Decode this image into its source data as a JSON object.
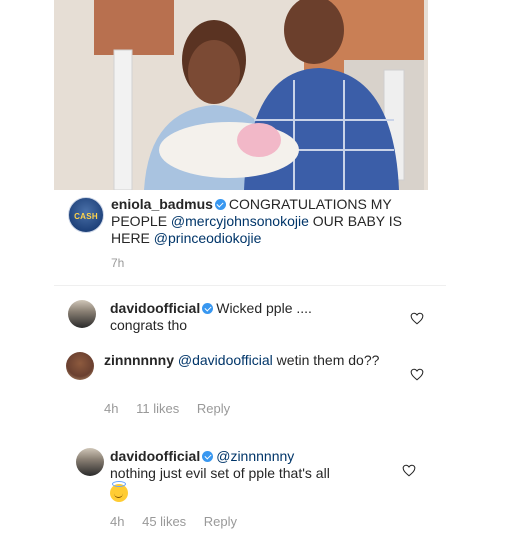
{
  "post": {
    "caption": {
      "username": "eniola_badmus",
      "avatar_text": "CASH",
      "segments": [
        {
          "t": "CONGRATULATIONS MY PEOPLE "
        },
        {
          "t": "@mercyjohnsonokojie",
          "mention": true
        },
        {
          "t": " OUR BABY IS HERE "
        },
        {
          "t": "@princeodiokojie",
          "mention": true
        }
      ],
      "time": "7h"
    }
  },
  "comments": [
    {
      "username": "davidoofficial",
      "verified": true,
      "text": "Wicked pple ....\ncongrats tho",
      "meta": null
    },
    {
      "username": "zinnnnnny",
      "verified": false,
      "mention": "@davidoofficial",
      "text": " wetin them do??",
      "time": "4h",
      "likes": "11 likes",
      "reply": "Reply"
    },
    {
      "username": "davidoofficial",
      "verified": true,
      "mention": "@zinnnnnny",
      "text": "nothing just evil set of pple that's all",
      "time": "4h",
      "likes": "45 likes",
      "reply": "Reply"
    }
  ],
  "icons": {
    "heart": "heart-outline-icon",
    "verified": "verified-badge-icon"
  },
  "colors": {
    "verified": "#3897f0",
    "mention": "#003569",
    "meta": "#999999"
  }
}
